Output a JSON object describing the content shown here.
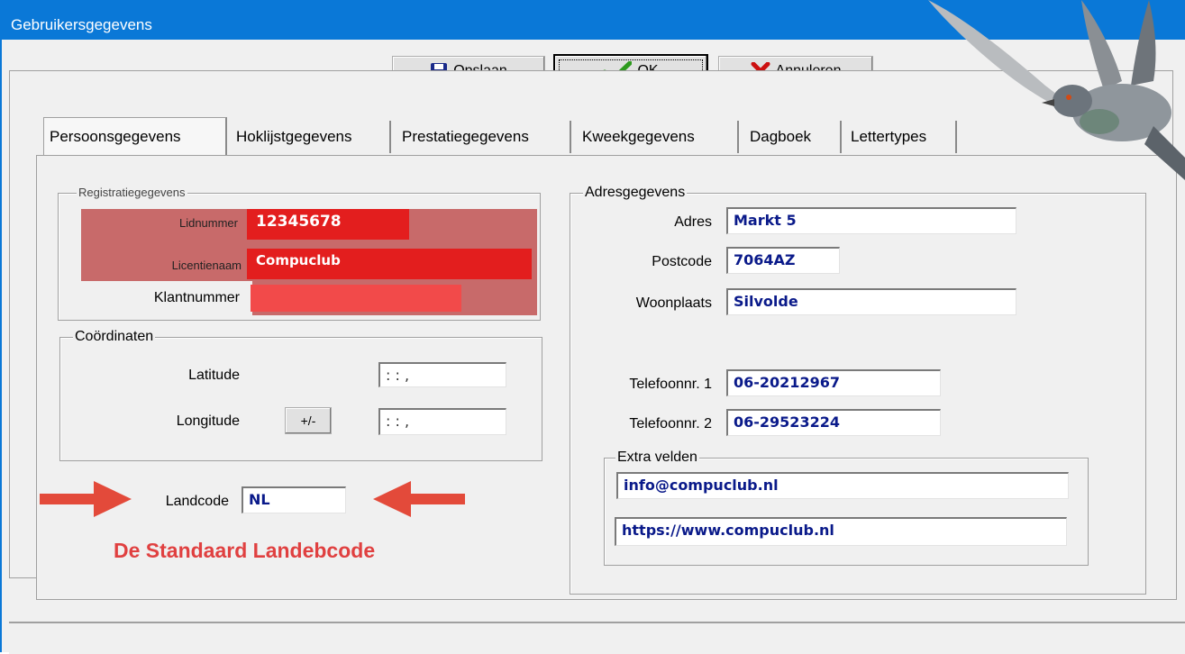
{
  "window": {
    "title": "Gebruikersgegevens"
  },
  "toolbar": {
    "save_label": "Opslaan",
    "ok_label": "OK",
    "cancel_label": "Annuleren"
  },
  "tabs": [
    {
      "label": "Persoonsgegevens"
    },
    {
      "label": "Hoklijstgegevens"
    },
    {
      "label": "Prestatiegegevens"
    },
    {
      "label": "Kweekgegevens"
    },
    {
      "label": "Dagboek"
    },
    {
      "label": "Lettertypes"
    }
  ],
  "registratie": {
    "title": "Registratiegegevens",
    "lidnummer_label": "Lidnummer",
    "lidnummer_value": "12345678",
    "licentienaam_label": "Licentienaam",
    "licentienaam_value": "Compuclub",
    "klantnummer_label": "Klantnummer",
    "klantnummer_value": ""
  },
  "coordinaten": {
    "title": "Coördinaten",
    "latitude_label": "Latitude",
    "latitude_value": " :  :  ,",
    "longitude_label": "Longitude",
    "sign_button": "+/-",
    "longitude_value": " :  :  ,"
  },
  "landcode": {
    "label": "Landcode",
    "value": "NL",
    "note": "De Standaard Landebcode"
  },
  "adres": {
    "title": "Adresgegevens",
    "adres_label": "Adres",
    "adres_value": "Markt 5",
    "postcode_label": "Postcode",
    "postcode_value": "7064AZ",
    "woonplaats_label": "Woonplaats",
    "woonplaats_value": "Silvolde",
    "tel1_label": "Telefoonnr. 1",
    "tel1_value": "06-20212967",
    "tel2_label": "Telefoonnr. 2",
    "tel2_value": "06-29523224"
  },
  "extra": {
    "title": "Extra velden",
    "field1": "info@compuclub.nl",
    "field2": "https://www.compuclub.nl"
  },
  "colors": {
    "titlebar": "#0a78d7",
    "red_field": "#e31e1e",
    "value_text": "#0a1a8a",
    "annotation": "#e04040"
  }
}
